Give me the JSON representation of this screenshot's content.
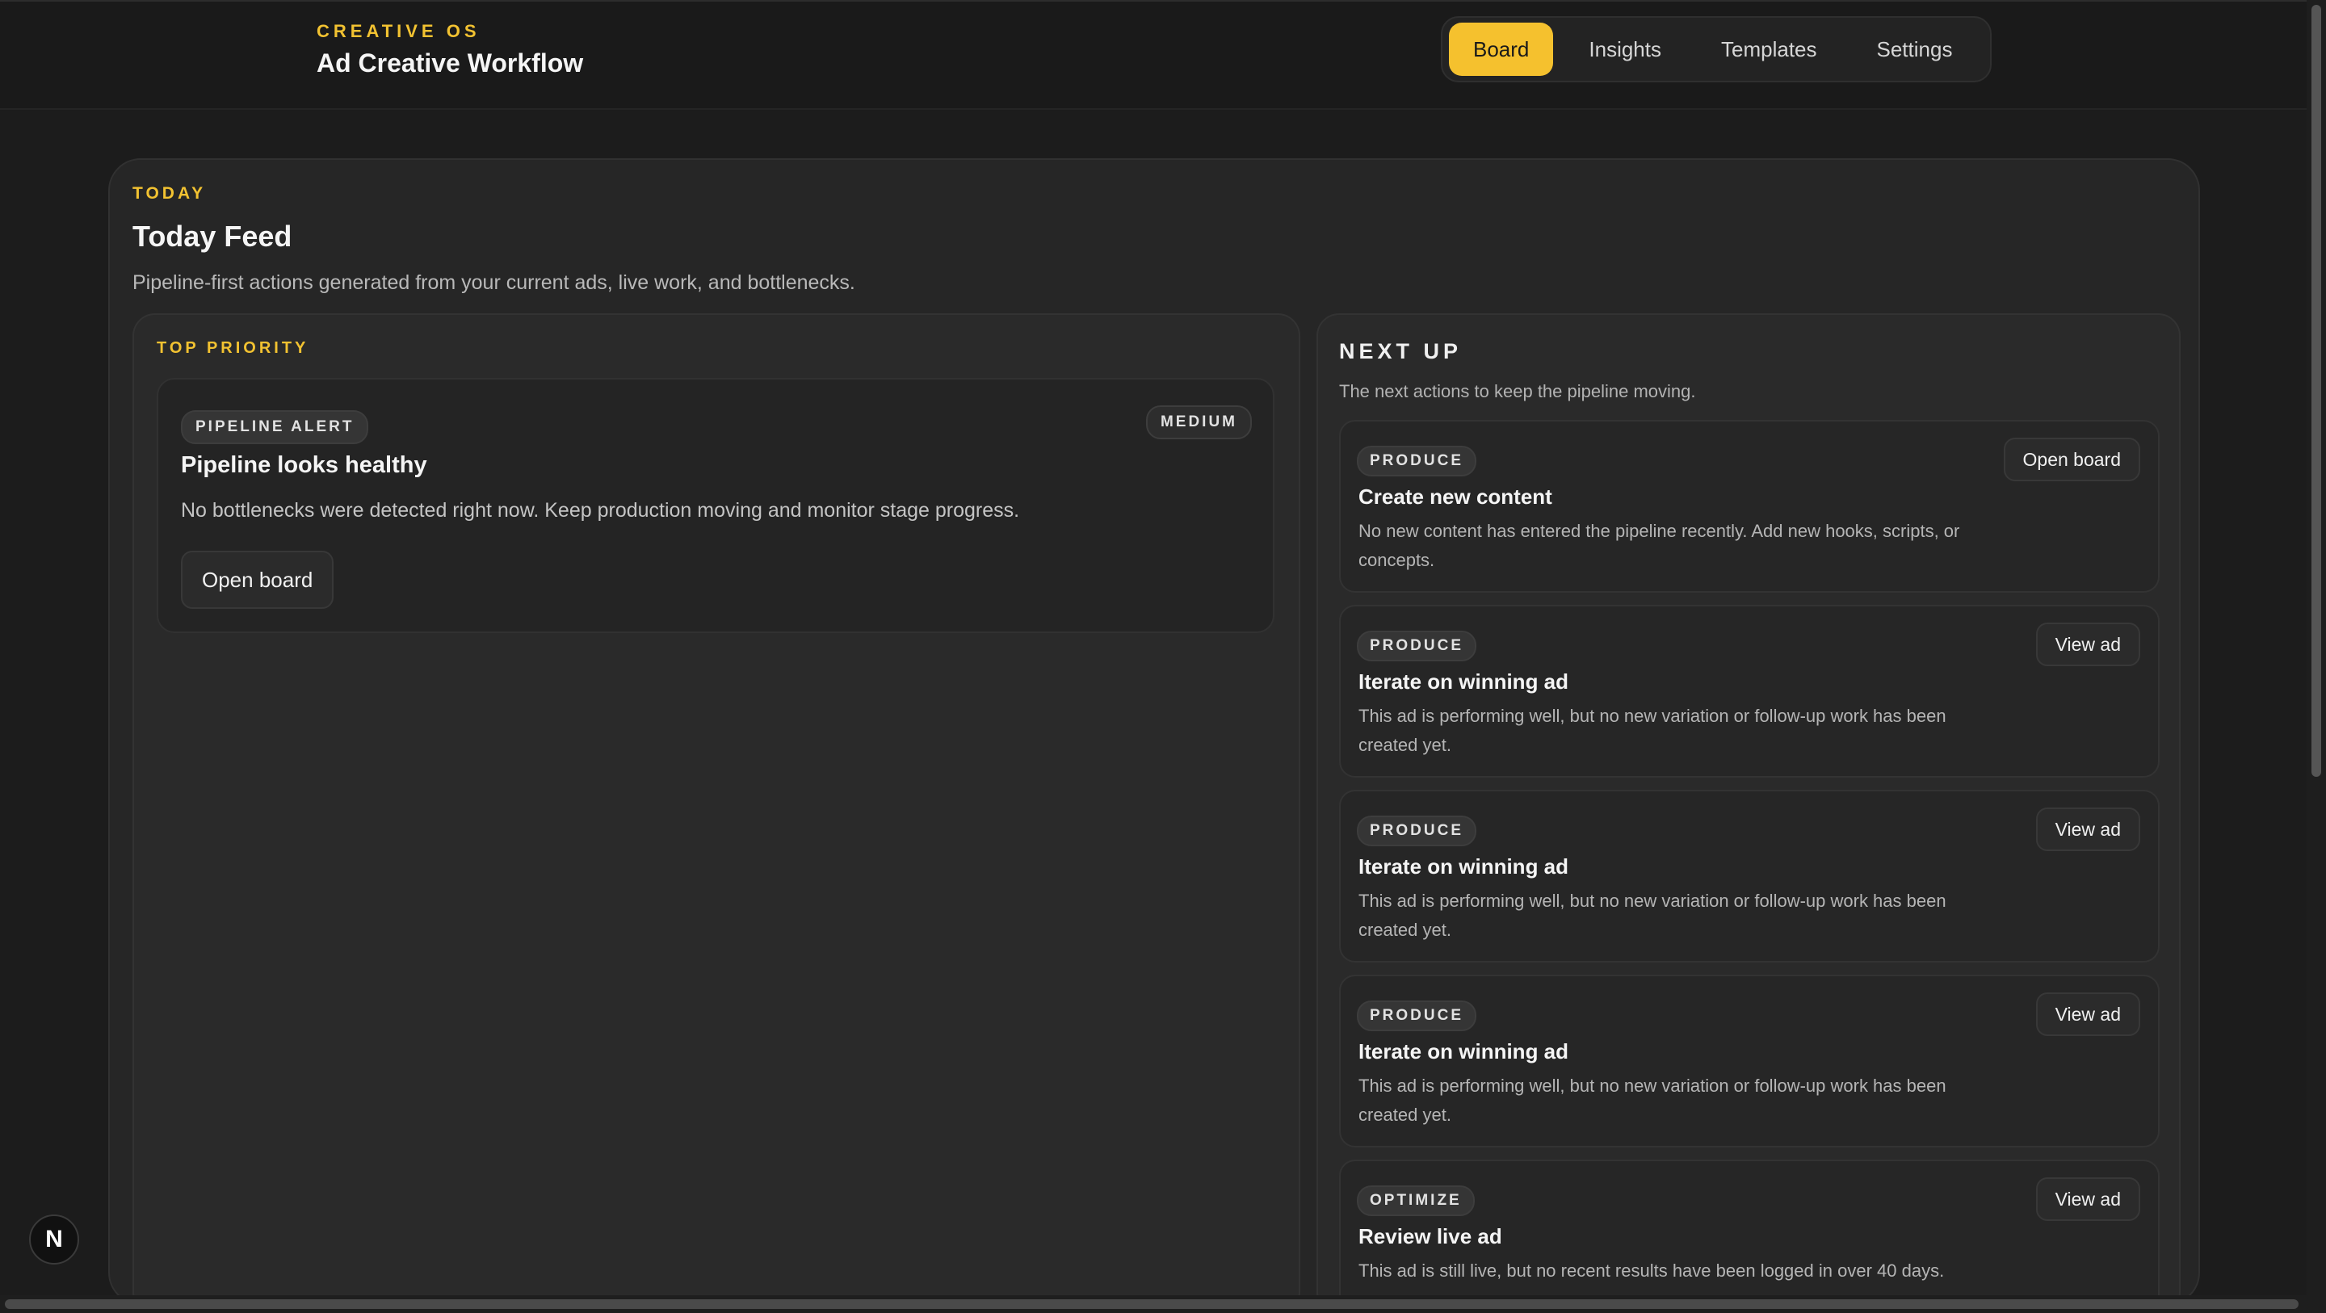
{
  "header": {
    "eyebrow": "CREATIVE OS",
    "title": "Ad Creative Workflow",
    "tabs": [
      {
        "label": "Board",
        "active": true
      },
      {
        "label": "Insights",
        "active": false
      },
      {
        "label": "Templates",
        "active": false
      },
      {
        "label": "Settings",
        "active": false
      }
    ]
  },
  "main": {
    "eyebrow": "TODAY",
    "title": "Today Feed",
    "subtitle": "Pipeline-first actions generated from your current ads, live work, and bottlenecks."
  },
  "top_priority": {
    "eyebrow": "TOP PRIORITY",
    "chip": "PIPELINE ALERT",
    "severity": "MEDIUM",
    "title": "Pipeline looks healthy",
    "description": "No bottlenecks were detected right now. Keep production moving and monitor stage progress.",
    "button": "Open board"
  },
  "next_up": {
    "title": "NEXT UP",
    "subtitle": "The next actions to keep the pipeline moving.",
    "items": [
      {
        "chip": "PRODUCE",
        "title": "Create new content",
        "description": "No new content has entered the pipeline recently. Add new hooks, scripts, or concepts.",
        "button": "Open board"
      },
      {
        "chip": "PRODUCE",
        "title": "Iterate on winning ad",
        "description": "This ad is performing well, but no new variation or follow-up work has been created yet.",
        "button": "View ad"
      },
      {
        "chip": "PRODUCE",
        "title": "Iterate on winning ad",
        "description": "This ad is performing well, but no new variation or follow-up work has been created yet.",
        "button": "View ad"
      },
      {
        "chip": "PRODUCE",
        "title": "Iterate on winning ad",
        "description": "This ad is performing well, but no new variation or follow-up work has been created yet.",
        "button": "View ad"
      },
      {
        "chip": "OPTIMIZE",
        "title": "Review live ad",
        "description": "This ad is still live, but no recent results have been logged in over 40 days.",
        "button": "View ad"
      }
    ]
  },
  "badge": {
    "letter": "N"
  },
  "colors": {
    "accent": "#f5c12e",
    "background": "#1c1c1c",
    "panel": "#262626"
  }
}
